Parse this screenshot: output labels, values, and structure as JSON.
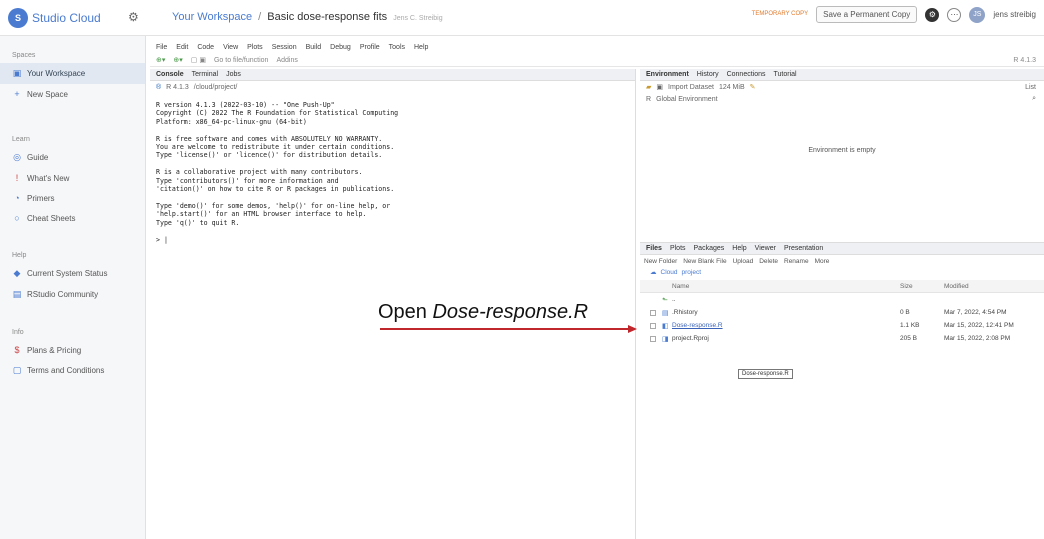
{
  "header": {
    "logo_letters": "S",
    "brand": "Studio Cloud",
    "breadcrumb_workspace": "Your Workspace",
    "breadcrumb_separator": "/",
    "project_title": "Basic dose-response fits",
    "project_owner": "Jens C. Streibig",
    "temporary_badge": "TEMPORARY COPY",
    "save_button": "Save a Permanent Copy",
    "user_initials": "JS",
    "user_name": "jens streibig"
  },
  "sidebar": {
    "spaces_label": "Spaces",
    "spaces": [
      {
        "label": "Your Workspace",
        "icon": "workspace-icon"
      },
      {
        "label": "New Space",
        "icon": "plus-icon"
      }
    ],
    "learn_label": "Learn",
    "learn": [
      {
        "label": "Guide",
        "icon": "guide-icon"
      },
      {
        "label": "What's New",
        "icon": "whats-new-icon"
      },
      {
        "label": "Primers",
        "icon": "primers-icon"
      },
      {
        "label": "Cheat Sheets",
        "icon": "cheat-sheets-icon"
      }
    ],
    "help_label": "Help",
    "help": [
      {
        "label": "Current System Status",
        "icon": "status-icon"
      },
      {
        "label": "RStudio Community",
        "icon": "community-icon"
      }
    ],
    "info_label": "Info",
    "info": [
      {
        "label": "Plans & Pricing",
        "icon": "pricing-icon"
      },
      {
        "label": "Terms and Conditions",
        "icon": "terms-icon"
      }
    ]
  },
  "menubar": [
    "File",
    "Edit",
    "Code",
    "View",
    "Plots",
    "Session",
    "Build",
    "Debug",
    "Profile",
    "Tools",
    "Help"
  ],
  "toolbar": {
    "goto_placeholder": "Go to file/function",
    "addins": "Addins",
    "project_label": "R 4.1.3"
  },
  "console": {
    "tabs": [
      "Console",
      "Terminal",
      "Jobs"
    ],
    "r_version": "R 4.1.3",
    "path": "/cloud/project/",
    "output": "R version 4.1.3 (2022-03-10) -- \"One Push-Up\"\nCopyright (C) 2022 The R Foundation for Statistical Computing\nPlatform: x86_64-pc-linux-gnu (64-bit)\n\nR is free software and comes with ABSOLUTELY NO WARRANTY.\nYou are welcome to redistribute it under certain conditions.\nType 'license()' or 'licence()' for distribution details.\n\nR is a collaborative project with many contributors.\nType 'contributors()' for more information and\n'citation()' on how to cite R or R packages in publications.\n\nType 'demo()' for some demos, 'help()' for on-line help, or\n'help.start()' for an HTML browser interface to help.\nType 'q()' to quit R.\n\n> |"
  },
  "environment": {
    "tabs": [
      "Environment",
      "History",
      "Connections",
      "Tutorial"
    ],
    "import_dataset": "Import Dataset",
    "memory": "124 MiB",
    "r_selector": "R",
    "scope": "Global Environment",
    "list_view": "List",
    "empty_message": "Environment is empty"
  },
  "files": {
    "tabs": [
      "Files",
      "Plots",
      "Packages",
      "Help",
      "Viewer",
      "Presentation"
    ],
    "actions": [
      "New Folder",
      "New Blank File",
      "Upload",
      "Delete",
      "Rename",
      "More"
    ],
    "path": [
      "Cloud",
      "project"
    ],
    "columns": {
      "name": "Name",
      "size": "Size",
      "modified": "Modified"
    },
    "up_label": "..",
    "rows": [
      {
        "name": ".Rhistory",
        "size": "0 B",
        "modified": "Mar 7, 2022, 4:54 PM",
        "link": false
      },
      {
        "name": "Dose-response.R",
        "size": "1.1 KB",
        "modified": "Mar 15, 2022, 12:41 PM",
        "link": true
      },
      {
        "name": "project.Rproj",
        "size": "205 B",
        "modified": "Mar 15, 2022, 2:08 PM",
        "link": false
      }
    ],
    "tooltip": "Dose-response.R"
  },
  "annotation": {
    "prefix": "Open ",
    "filename": "Dose-response.R",
    "color": "#c0272d"
  }
}
